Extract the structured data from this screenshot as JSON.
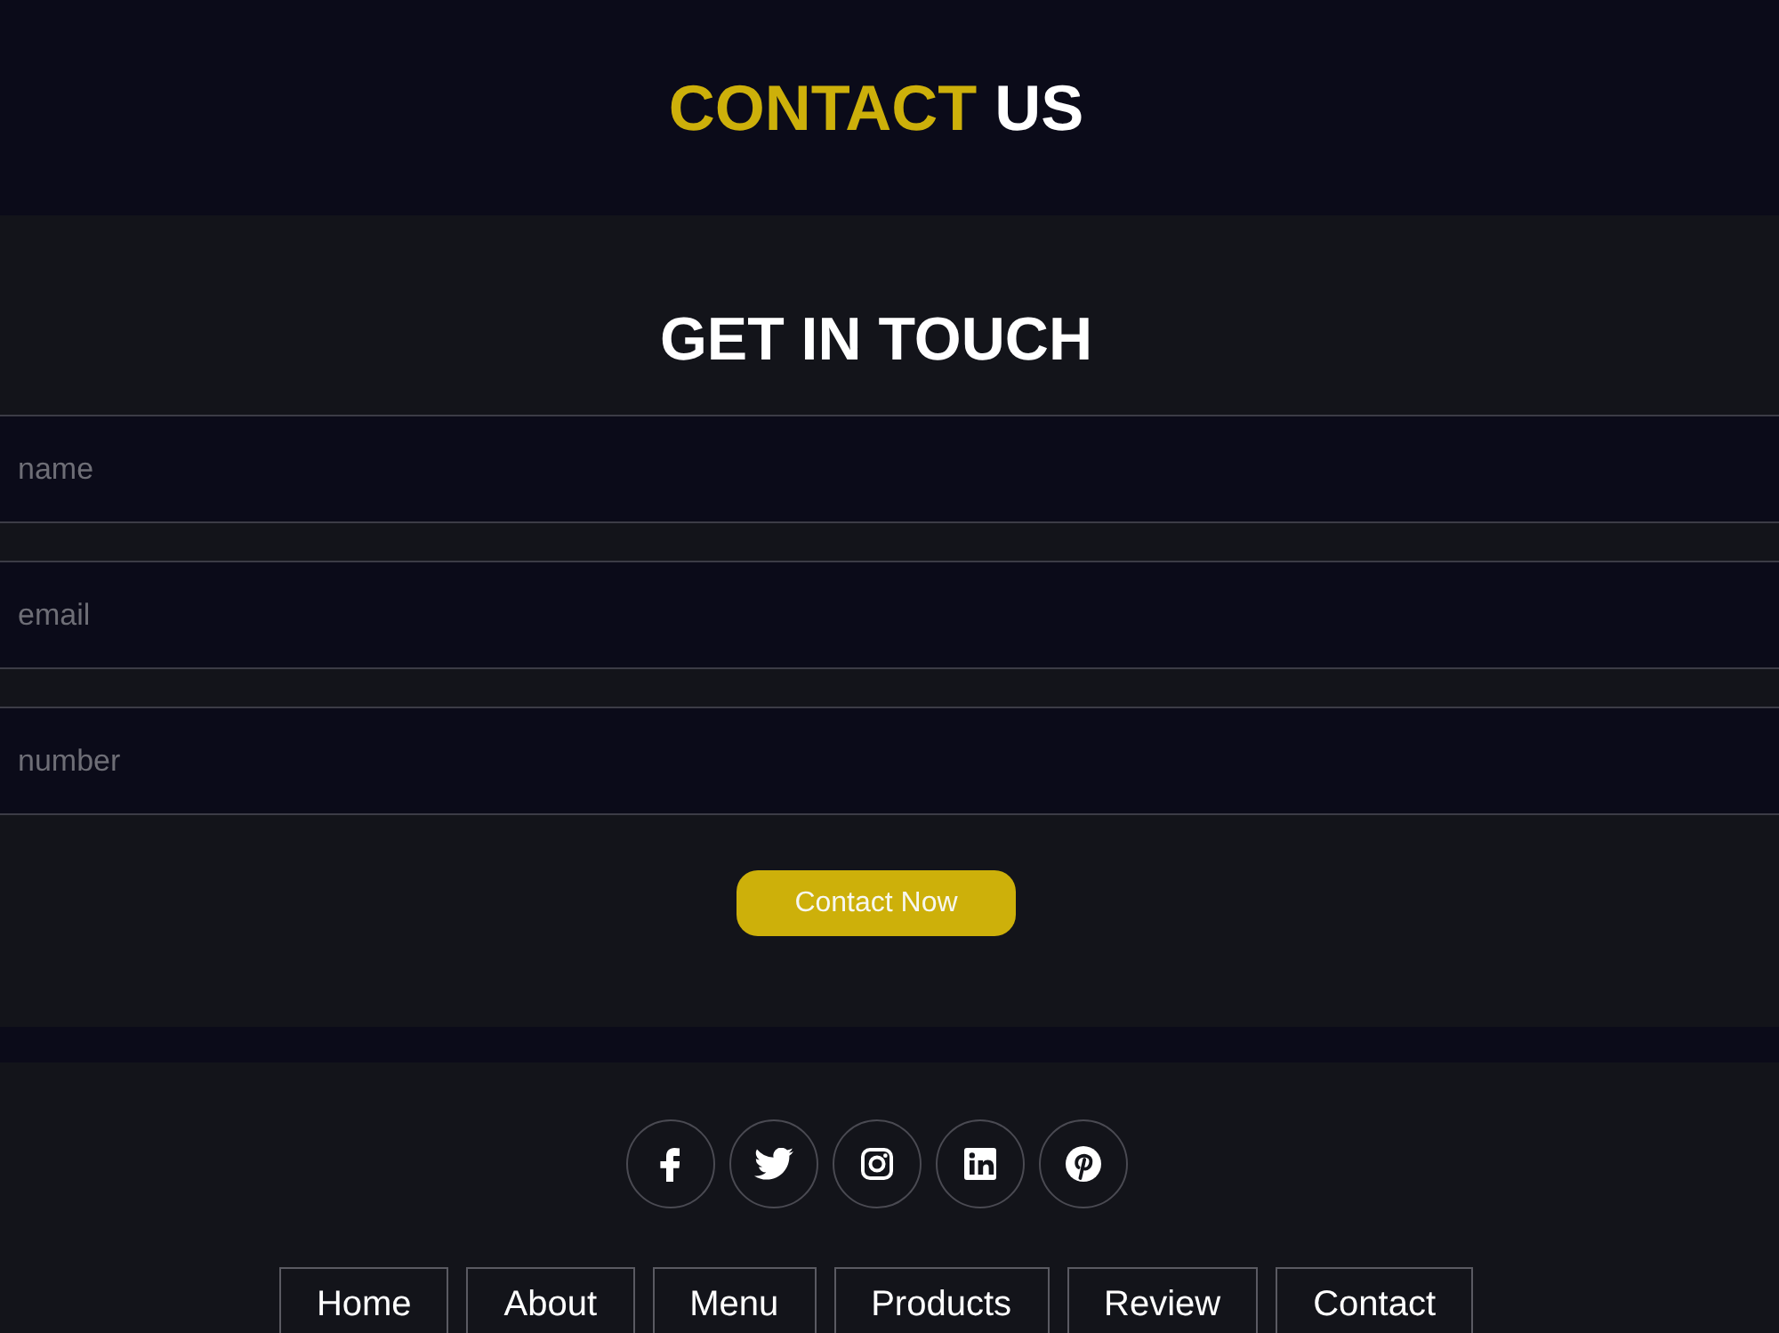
{
  "header": {
    "title_highlight": "CONTACT",
    "title_rest": "US"
  },
  "contact_form": {
    "heading": "GET IN TOUCH",
    "fields": [
      {
        "placeholder": "name"
      },
      {
        "placeholder": "email"
      },
      {
        "placeholder": "number"
      }
    ],
    "submit_button": "Contact Now"
  },
  "footer": {
    "social_links": [
      {
        "kind": "facebook"
      },
      {
        "kind": "twitter"
      },
      {
        "kind": "instagram"
      },
      {
        "kind": "linkedin"
      },
      {
        "kind": "pinterest"
      }
    ],
    "nav_links": [
      "Home",
      "About",
      "Menu",
      "Products",
      "Review",
      "Contact"
    ]
  }
}
